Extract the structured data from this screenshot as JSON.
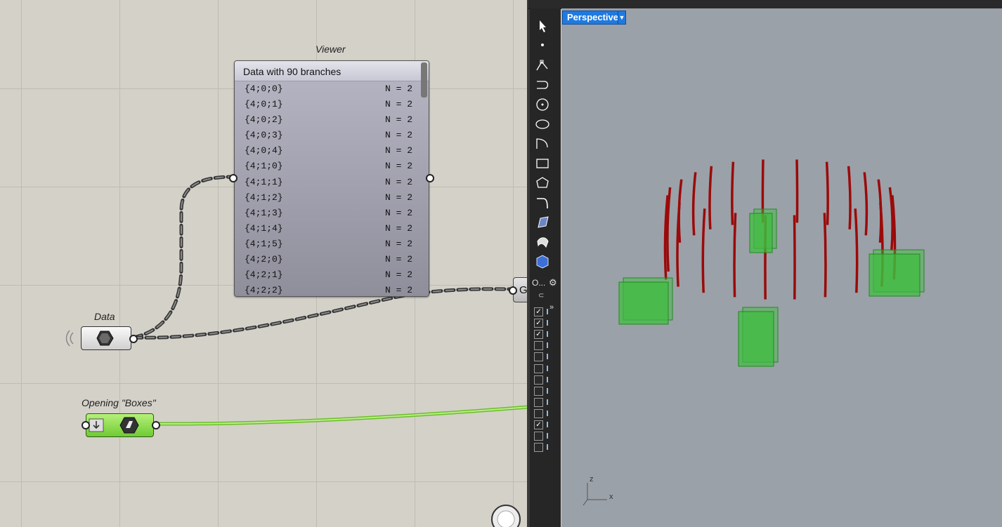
{
  "canvas": {
    "viewer": {
      "label": "Viewer",
      "header": "Data with 90 branches",
      "rows": [
        {
          "path": "{4;0;0}",
          "count": "N = 2"
        },
        {
          "path": "{4;0;1}",
          "count": "N = 2"
        },
        {
          "path": "{4;0;2}",
          "count": "N = 2"
        },
        {
          "path": "{4;0;3}",
          "count": "N = 2"
        },
        {
          "path": "{4;0;4}",
          "count": "N = 2"
        },
        {
          "path": "{4;1;0}",
          "count": "N = 2"
        },
        {
          "path": "{4;1;1}",
          "count": "N = 2"
        },
        {
          "path": "{4;1;2}",
          "count": "N = 2"
        },
        {
          "path": "{4;1;3}",
          "count": "N = 2"
        },
        {
          "path": "{4;1;4}",
          "count": "N = 2"
        },
        {
          "path": "{4;1;5}",
          "count": "N = 2"
        },
        {
          "path": "{4;2;0}",
          "count": "N = 2"
        },
        {
          "path": "{4;2;1}",
          "count": "N = 2"
        },
        {
          "path": "{4;2;2}",
          "count": "N = 2"
        }
      ]
    },
    "data_param": {
      "label": "Data"
    },
    "opening_boxes": {
      "label": "Opening \"Boxes\""
    },
    "g_component": {
      "label": "G"
    }
  },
  "rhino": {
    "viewport_tab": "Perspective",
    "layers_label": "O...",
    "axis_labels": {
      "z": "z",
      "x": "x"
    },
    "layer_checks": [
      true,
      true,
      true,
      false,
      false,
      false,
      false,
      false,
      false,
      false,
      true,
      false,
      false
    ],
    "colors": {
      "curves": "#9b0a0a",
      "boxes": "#3cbf3c",
      "viewport_bg": "#9ba1a8",
      "tab": "#1f7ae0"
    }
  }
}
